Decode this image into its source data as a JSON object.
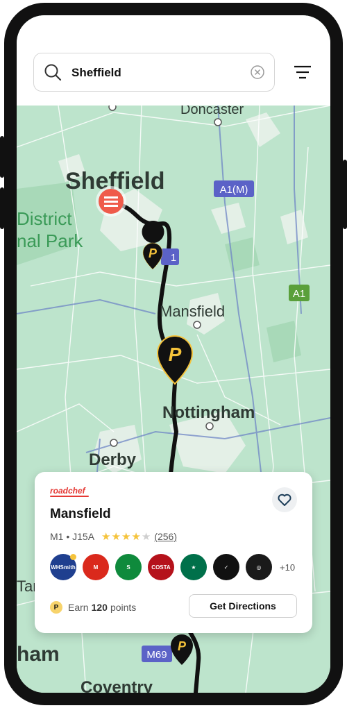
{
  "search": {
    "value": "Sheffield"
  },
  "map": {
    "labels": {
      "doncaster": "Doncaster",
      "sheffield": "Sheffield",
      "district": "District",
      "national_park": "nal Park",
      "mansfield": "Mansfield",
      "nottingham": "Nottingham",
      "derby": "Derby",
      "tam": "Tam",
      "ham": "ham",
      "coventry": "Coventry"
    },
    "road_badges": {
      "a1m": "A1(M)",
      "a1": "A1",
      "m1": "1",
      "m69": "M69"
    },
    "pin_letter": "P"
  },
  "card": {
    "brand": "roadchef",
    "title": "Mansfield",
    "motorway": "M1 • J15A",
    "rating": 4,
    "review_count": "(256)",
    "brands": [
      {
        "name": "WHSmith",
        "color": "#1f3f8f",
        "text": "WHSmith"
      },
      {
        "name": "McDonald's",
        "color": "#da291c",
        "text": "M"
      },
      {
        "name": "Subway",
        "color": "#0f8a3c",
        "text": "S"
      },
      {
        "name": "Costa",
        "color": "#b5121b",
        "text": "COSTA"
      },
      {
        "name": "Starbucks",
        "color": "#00704a",
        "text": "★"
      },
      {
        "name": "Nike",
        "color": "#111111",
        "text": "✓"
      },
      {
        "name": "Pizza Express",
        "color": "#1a1a1a",
        "text": "◎"
      }
    ],
    "more_brands": "+10",
    "earn_prefix": "Earn",
    "earn_points": "120",
    "earn_suffix": "points",
    "directions_label": "Get Directions"
  },
  "colors": {
    "route": "#111111",
    "pin": "#f5c33b",
    "map_bg": "#bfe6cf"
  }
}
